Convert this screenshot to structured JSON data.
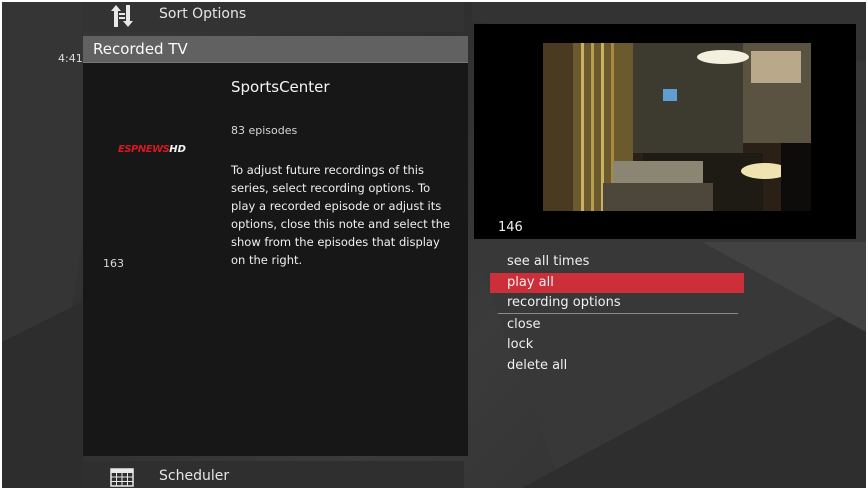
{
  "top_menu": {
    "label": "Sort Options",
    "icon": "sort-icon"
  },
  "clock": {
    "time": "4:41"
  },
  "panel": {
    "title": "Recorded TV",
    "show_title": "SportsCenter",
    "episodes": "83 episodes",
    "description": "To adjust future recordings of this series, select recording options. To play a recorded episode or adjust its options, close this note and select the show from the episodes that display on the right.",
    "channel_logo": {
      "brand": "ESPNEWS",
      "suffix": "HD"
    },
    "left_count": "163"
  },
  "video": {
    "number": "146"
  },
  "menu": {
    "items": [
      {
        "label": "see all times",
        "selected": false
      },
      {
        "label": "play all",
        "selected": true
      },
      {
        "label": "recording options",
        "selected": false
      },
      {
        "label": "close",
        "selected": false
      },
      {
        "label": "lock",
        "selected": false
      },
      {
        "label": "delete all",
        "selected": false
      }
    ]
  },
  "bottom_menu": {
    "label": "Scheduler",
    "icon": "calendar-icon"
  },
  "colors": {
    "selected": "#cc2f3a",
    "panel_bg": "#171717",
    "header_bg": "#616161",
    "logo_red": "#d11a22"
  }
}
